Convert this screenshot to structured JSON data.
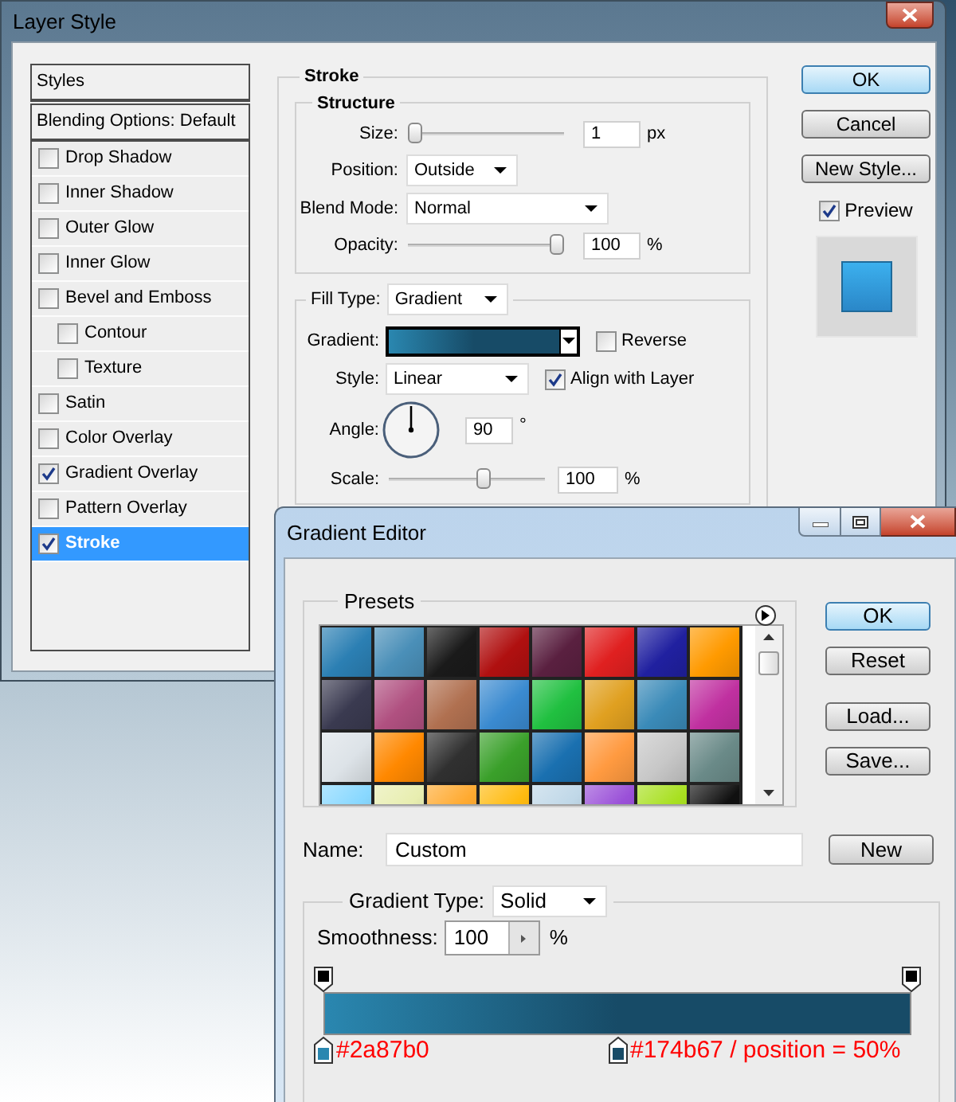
{
  "layer_style": {
    "title": "Layer Style",
    "styles_header": "Styles",
    "blending_options": "Blending Options: Default",
    "effects": [
      {
        "label": "Drop Shadow",
        "checked": false,
        "selected": false
      },
      {
        "label": "Inner Shadow",
        "checked": false,
        "selected": false
      },
      {
        "label": "Outer Glow",
        "checked": false,
        "selected": false
      },
      {
        "label": "Inner Glow",
        "checked": false,
        "selected": false
      },
      {
        "label": "Bevel and Emboss",
        "checked": false,
        "selected": false,
        "children": [
          {
            "label": "Contour",
            "checked": false,
            "selected": false
          },
          {
            "label": "Texture",
            "checked": false,
            "selected": false
          }
        ]
      },
      {
        "label": "Satin",
        "checked": false,
        "selected": false
      },
      {
        "label": "Color Overlay",
        "checked": false,
        "selected": false
      },
      {
        "label": "Gradient Overlay",
        "checked": true,
        "selected": false
      },
      {
        "label": "Pattern Overlay",
        "checked": false,
        "selected": false
      },
      {
        "label": "Stroke",
        "checked": true,
        "selected": true
      }
    ],
    "stroke": {
      "title": "Stroke",
      "structure": {
        "title": "Structure",
        "size": {
          "label": "Size:",
          "level": 0,
          "value": "1",
          "unit": "px"
        },
        "position": {
          "label": "Position:",
          "value": "Outside"
        },
        "blend_mode": {
          "label": "Blend Mode:",
          "value": "Normal"
        },
        "opacity": {
          "label": "Opacity:",
          "level": 1,
          "value": "100",
          "unit": "%"
        }
      },
      "fill": {
        "fill_type": {
          "label": "Fill Type:",
          "value": "Gradient"
        },
        "gradient": {
          "label": "Gradient:"
        },
        "reverse": {
          "label": "Reverse",
          "checked": false
        },
        "style": {
          "label": "Style:",
          "value": "Linear"
        },
        "align": {
          "label": "Align with Layer",
          "checked": true
        },
        "angle": {
          "label": "Angle:",
          "value": "90",
          "unit": "°",
          "level": 0.25
        },
        "scale": {
          "label": "Scale:",
          "level": 0.62,
          "value": "100",
          "unit": "%"
        }
      }
    },
    "buttons": [
      {
        "label": "OK",
        "default": true
      },
      {
        "label": "Cancel",
        "default": false
      },
      {
        "label": "New Style...",
        "default": false
      }
    ],
    "preview": {
      "label": "Preview",
      "checked": true
    }
  },
  "gradient_editor": {
    "title": "Gradient Editor",
    "presets": {
      "title": "Presets",
      "items": [
        {
          "color": "#2b7fb3"
        },
        {
          "color": "#4a8fb8"
        },
        {
          "color": "#1a1a1a"
        },
        {
          "color": "#b01010"
        },
        {
          "color": "#5a2040"
        },
        {
          "color": "#e02020"
        },
        {
          "color": "#2020a0"
        },
        {
          "color": "#ff9a00"
        },
        {
          "color": "#3a3a50"
        },
        {
          "color": "#b05080"
        },
        {
          "color": "#b07050"
        },
        {
          "color": "#3a8ad0"
        },
        {
          "color": "#20c040"
        },
        {
          "color": "#e0a020"
        },
        {
          "color": "#3a8ab8"
        },
        {
          "color": "#c030a0"
        },
        {
          "color": "#dde3e8"
        },
        {
          "color": "#ff8800"
        },
        {
          "color": "#303030"
        },
        {
          "color": "#3aa02a"
        },
        {
          "color": "#1a70b0"
        },
        {
          "color": "#ff9a40"
        },
        {
          "color": "#c8c8c8"
        },
        {
          "color": "#6a8a88"
        },
        {
          "color": "#88d8ff"
        },
        {
          "color": "#e8eeb0"
        },
        {
          "color": "#ffaa30"
        },
        {
          "color": "#ffbb10"
        },
        {
          "color": "#c0d8e8"
        },
        {
          "color": "#9a50d8"
        },
        {
          "color": "#a8e020"
        },
        {
          "color": "#101010"
        }
      ]
    },
    "buttons": [
      {
        "label": "OK",
        "default": true
      },
      {
        "label": "Reset",
        "default": false
      },
      {
        "label": "Load...",
        "default": false
      },
      {
        "label": "Save...",
        "default": false
      }
    ],
    "name": {
      "label": "Name:",
      "value": "Custom"
    },
    "new_button": "New",
    "gradient_type": {
      "label": "Gradient Type:",
      "value": "Solid"
    },
    "smoothness": {
      "label": "Smoothness:",
      "value": "100",
      "unit": "%"
    },
    "opacity_stops": [
      {
        "level": 0
      },
      {
        "level": 1
      }
    ],
    "color_stops": [
      {
        "color": "#2a87b0",
        "level": 0,
        "note": "#2a87b0"
      },
      {
        "color": "#174b67",
        "level": 0.5,
        "note": "#174b67 / position = 50%"
      }
    ]
  }
}
